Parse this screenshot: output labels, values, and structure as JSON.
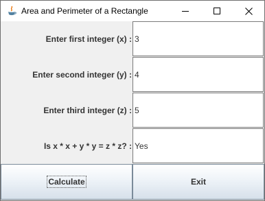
{
  "window": {
    "title": "Area and Perimeter of a Rectangle",
    "controls": {
      "minimize": "minimize-icon",
      "maximize": "maximize-icon",
      "close": "close-icon"
    }
  },
  "form": {
    "rows": [
      {
        "label": "Enter first integer (x) :",
        "value": "3"
      },
      {
        "label": "Enter second integer (y) :",
        "value": "4"
      },
      {
        "label": "Enter third integer (z) :",
        "value": "5"
      },
      {
        "label": "Is x * x + y * y = z * z? :",
        "value": "Yes"
      }
    ]
  },
  "buttons": {
    "calculate": "Calculate",
    "exit": "Exit"
  },
  "colors": {
    "label_text": "#333333",
    "field_border": "#7a7a7a",
    "background": "#f0f0f0"
  }
}
